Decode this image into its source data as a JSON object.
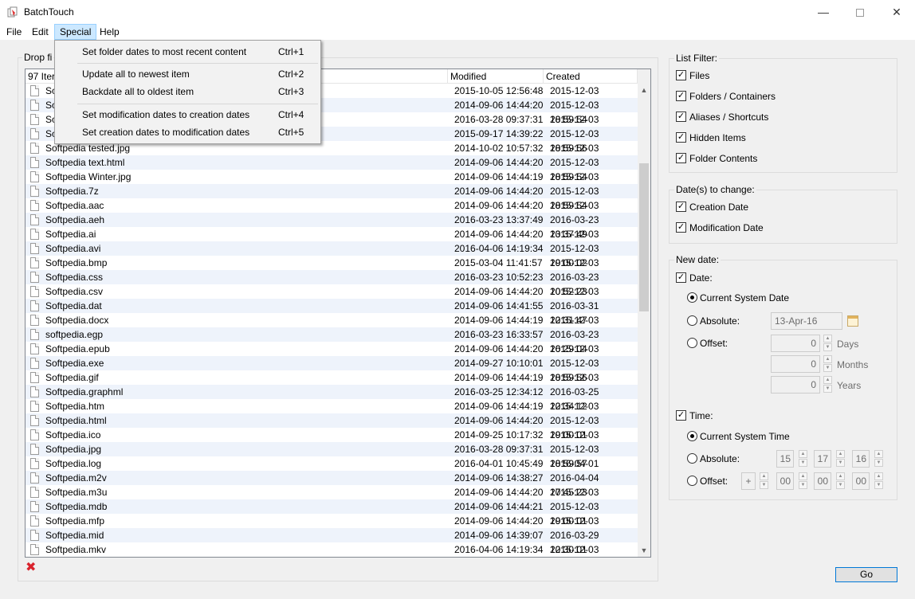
{
  "window": {
    "title": "BatchTouch",
    "minimize": "—",
    "close": "✕"
  },
  "menubar": [
    "File",
    "Edit",
    "Special",
    "Help"
  ],
  "special_menu": [
    {
      "label": "Set folder dates to most recent content",
      "shortcut": "Ctrl+1"
    },
    {
      "label": "Update all to newest item",
      "shortcut": "Ctrl+2"
    },
    {
      "label": "Backdate all to oldest item",
      "shortcut": "Ctrl+3"
    },
    {
      "label": "Set modification dates  to creation dates",
      "shortcut": "Ctrl+4"
    },
    {
      "label": "Set creation dates to modification dates",
      "shortcut": "Ctrl+5"
    }
  ],
  "drop_group": {
    "label": "Drop fi"
  },
  "filelist": {
    "headers": {
      "count": "97 Iter",
      "modified": "Modified",
      "created": "Created"
    },
    "rows": [
      {
        "name": "So",
        "modified": "2015-10-05 12:56:48",
        "created": "2015-12-03 19:00:01"
      },
      {
        "name": "So",
        "modified": "2014-09-06 14:44:20",
        "created": "2015-12-03 18:59:54"
      },
      {
        "name": "So",
        "modified": "2016-03-28 09:37:31",
        "created": "2015-12-03 18:59:54"
      },
      {
        "name": "So",
        "modified": "2015-09-17 14:39:22",
        "created": "2015-12-03 18:59:56"
      },
      {
        "name": "Softpedia tested.jpg",
        "modified": "2014-10-02 10:57:32",
        "created": "2015-12-03 18:59:54"
      },
      {
        "name": "Softpedia text.html",
        "modified": "2014-09-06 14:44:20",
        "created": "2015-12-03 18:59:54"
      },
      {
        "name": "Softpedia Winter.jpg",
        "modified": "2014-09-06 14:44:19",
        "created": "2015-12-03 18:59:56"
      },
      {
        "name": "Softpedia.7z",
        "modified": "2014-09-06 14:44:20",
        "created": "2015-12-03 18:59:54"
      },
      {
        "name": "Softpedia.aac",
        "modified": "2014-09-06 14:44:20",
        "created": "2015-12-03 18:59:57"
      },
      {
        "name": "Softpedia.aeh",
        "modified": "2016-03-23 13:37:49",
        "created": "2016-03-23 13:37:49"
      },
      {
        "name": "Softpedia.ai",
        "modified": "2014-09-06 14:44:20",
        "created": "2015-12-03 19:00:01"
      },
      {
        "name": "Softpedia.avi",
        "modified": "2016-04-06 14:19:34",
        "created": "2015-12-03 19:00:02"
      },
      {
        "name": "Softpedia.bmp",
        "modified": "2015-03-04 11:41:57",
        "created": "2015-12-03 18:59:57"
      },
      {
        "name": "Softpedia.css",
        "modified": "2016-03-23 10:52:23",
        "created": "2016-03-23 10:52:23"
      },
      {
        "name": "Softpedia.csv",
        "modified": "2014-09-06 14:44:20",
        "created": "2015-12-03 19:00:01"
      },
      {
        "name": "Softpedia.dat",
        "modified": "2014-09-06 14:41:55",
        "created": "2016-03-31 12:31:47"
      },
      {
        "name": "Softpedia.docx",
        "modified": "2014-09-06 14:44:19",
        "created": "2015-12-03 18:59:54"
      },
      {
        "name": "softpedia.egp",
        "modified": "2016-03-23 16:33:57",
        "created": "2016-03-23 16:29:04"
      },
      {
        "name": "Softpedia.epub",
        "modified": "2014-09-06 14:44:20",
        "created": "2015-12-03 18:59:57"
      },
      {
        "name": "Softpedia.exe",
        "modified": "2014-09-27 10:10:01",
        "created": "2015-12-03 18:59:56"
      },
      {
        "name": "Softpedia.gif",
        "modified": "2014-09-06 14:44:19",
        "created": "2015-12-03 18:59:54"
      },
      {
        "name": "Softpedia.graphml",
        "modified": "2016-03-25 12:34:12",
        "created": "2016-03-25 12:34:12"
      },
      {
        "name": "Softpedia.htm",
        "modified": "2014-09-06 14:44:19",
        "created": "2015-12-03 19:00:01"
      },
      {
        "name": "Softpedia.html",
        "modified": "2014-09-06 14:44:20",
        "created": "2015-12-03 19:00:01"
      },
      {
        "name": "Softpedia.ico",
        "modified": "2014-09-25 10:17:32",
        "created": "2015-12-03 19:00:01"
      },
      {
        "name": "Softpedia.jpg",
        "modified": "2016-03-28 09:37:31",
        "created": "2015-12-03 18:59:57"
      },
      {
        "name": "Softpedia.log",
        "modified": "2016-04-01 10:45:49",
        "created": "2016-04-01 10:45:45"
      },
      {
        "name": "Softpedia.m2v",
        "modified": "2014-09-06 14:38:27",
        "created": "2016-04-04 17:45:23"
      },
      {
        "name": "Softpedia.m3u",
        "modified": "2014-09-06 14:44:20",
        "created": "2015-12-03 19:00:01"
      },
      {
        "name": "Softpedia.mdb",
        "modified": "2014-09-06 14:44:21",
        "created": "2015-12-03 19:00:01"
      },
      {
        "name": "Softpedia.mfp",
        "modified": "2014-09-06 14:44:20",
        "created": "2015-12-03 19:00:01"
      },
      {
        "name": "Softpedia.mid",
        "modified": "2014-09-06 14:39:07",
        "created": "2016-03-29 12:30:01"
      },
      {
        "name": "Softpedia.mkv",
        "modified": "2016-04-06 14:19:34",
        "created": "2015-12-03 18:59:59"
      }
    ]
  },
  "list_filter": {
    "label": "List Filter:",
    "items": [
      {
        "label": "Files",
        "checked": true
      },
      {
        "label": "Folders / Containers",
        "checked": true
      },
      {
        "label": "Aliases / Shortcuts",
        "checked": true
      },
      {
        "label": "Hidden Items",
        "checked": true
      },
      {
        "label": "Folder Contents",
        "checked": true
      }
    ]
  },
  "dates_to_change": {
    "label": "Date(s) to change:",
    "items": [
      {
        "label": "Creation Date",
        "checked": true
      },
      {
        "label": "Modification Date",
        "checked": true
      }
    ]
  },
  "new_date": {
    "label": "New date:",
    "date_toggle": "Date:",
    "date_options": {
      "current": "Current System Date",
      "absolute": "Absolute:",
      "offset": "Offset:"
    },
    "absolute_date": "13-Apr-16",
    "offset_days": "0",
    "offset_months": "0",
    "offset_years": "0",
    "units": {
      "days": "Days",
      "months": "Months",
      "years": "Years"
    },
    "time_toggle": "Time:",
    "time_options": {
      "current": "Current System Time",
      "absolute": "Absolute:",
      "offset": "Offset:"
    },
    "abs_time": {
      "h": "15",
      "m": "17",
      "s": "16"
    },
    "offset_time": {
      "sign": "+",
      "h": "00",
      "m": "00",
      "s": "00"
    }
  },
  "check_glyph": "✓",
  "spin_up": "▲",
  "spin_down": "▼",
  "go_label": "Go",
  "clear_glyph": "✖",
  "colors": {
    "menu_highlight": "#cce8ff",
    "alt_row": "#eef3fb",
    "go_border": "#0078d7",
    "clear_red": "#d9232d"
  }
}
